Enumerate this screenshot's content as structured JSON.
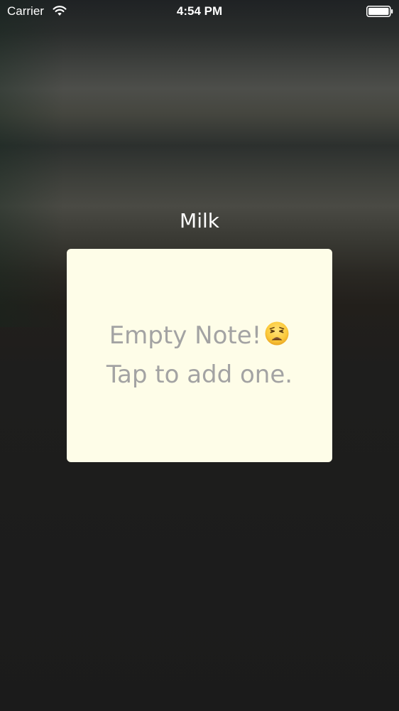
{
  "status_bar": {
    "carrier": "Carrier",
    "time": "4:54 PM",
    "wifi_icon": "wifi-icon",
    "battery_icon": "battery-full-icon"
  },
  "note": {
    "title": "Milk",
    "placeholder_line1": "Empty Note!",
    "placeholder_line2": "Tap to add one.",
    "emoji_icon": "weary-face-emoji-icon"
  },
  "colors": {
    "card_background": "#fefde8",
    "placeholder_text": "#a3a3a3",
    "title_text": "#ffffff"
  }
}
